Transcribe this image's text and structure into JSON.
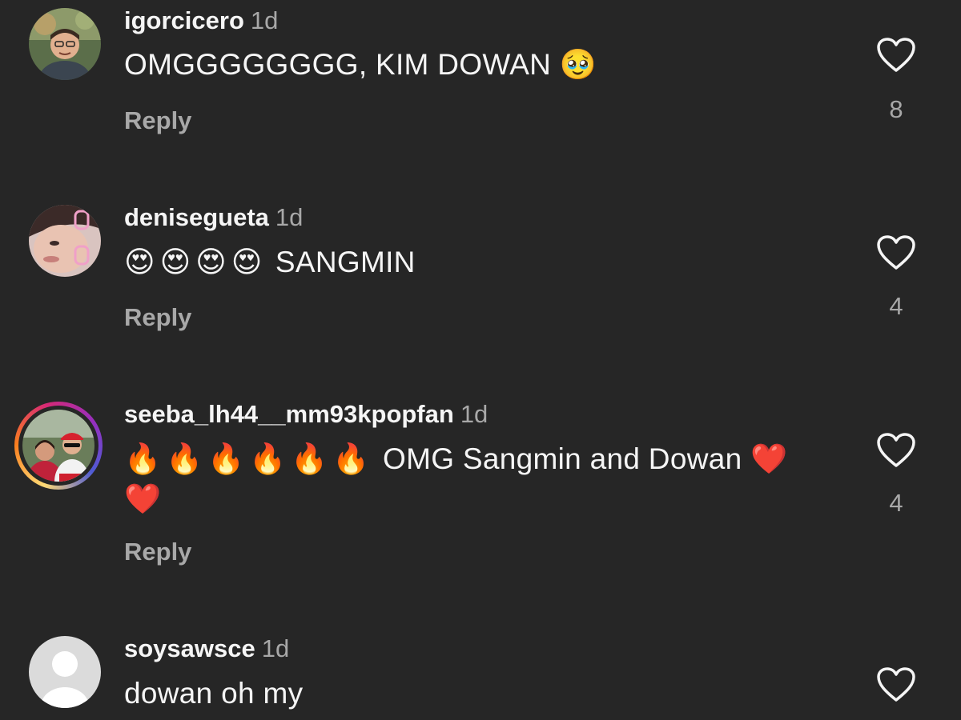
{
  "comments": [
    {
      "username": "igorcicero",
      "time": "1d",
      "text": "OMGGGGGGGG, KIM DOWAN",
      "emoji": "🥹",
      "reply_label": "Reply",
      "likes": "8",
      "avatar_icon": "user-photo-icon"
    },
    {
      "username": "denisegueta",
      "time": "1d",
      "emoji": "😍😍😍😍",
      "text": "SANGMIN",
      "reply_label": "Reply",
      "likes": "4",
      "avatar_icon": "user-photo-icon"
    },
    {
      "username": "seeba_lh44__mm93kpopfan",
      "time": "1d",
      "emoji": "🔥🔥🔥🔥🔥🔥",
      "text": "OMG Sangmin and Dowan",
      "emoji_after": "❤️❤️",
      "reply_label": "Reply",
      "likes": "4",
      "avatar_icon": "user-photo-icon",
      "story_ring": true
    },
    {
      "username": "soysawsce",
      "time": "1d",
      "text": "dowan oh my",
      "avatar_icon": "default-avatar-icon"
    }
  ],
  "colors": {
    "background": "#262626",
    "primary_text": "#f5f5f5",
    "secondary_text": "#a8a8a8"
  },
  "like_icon": "heart-outline-icon"
}
